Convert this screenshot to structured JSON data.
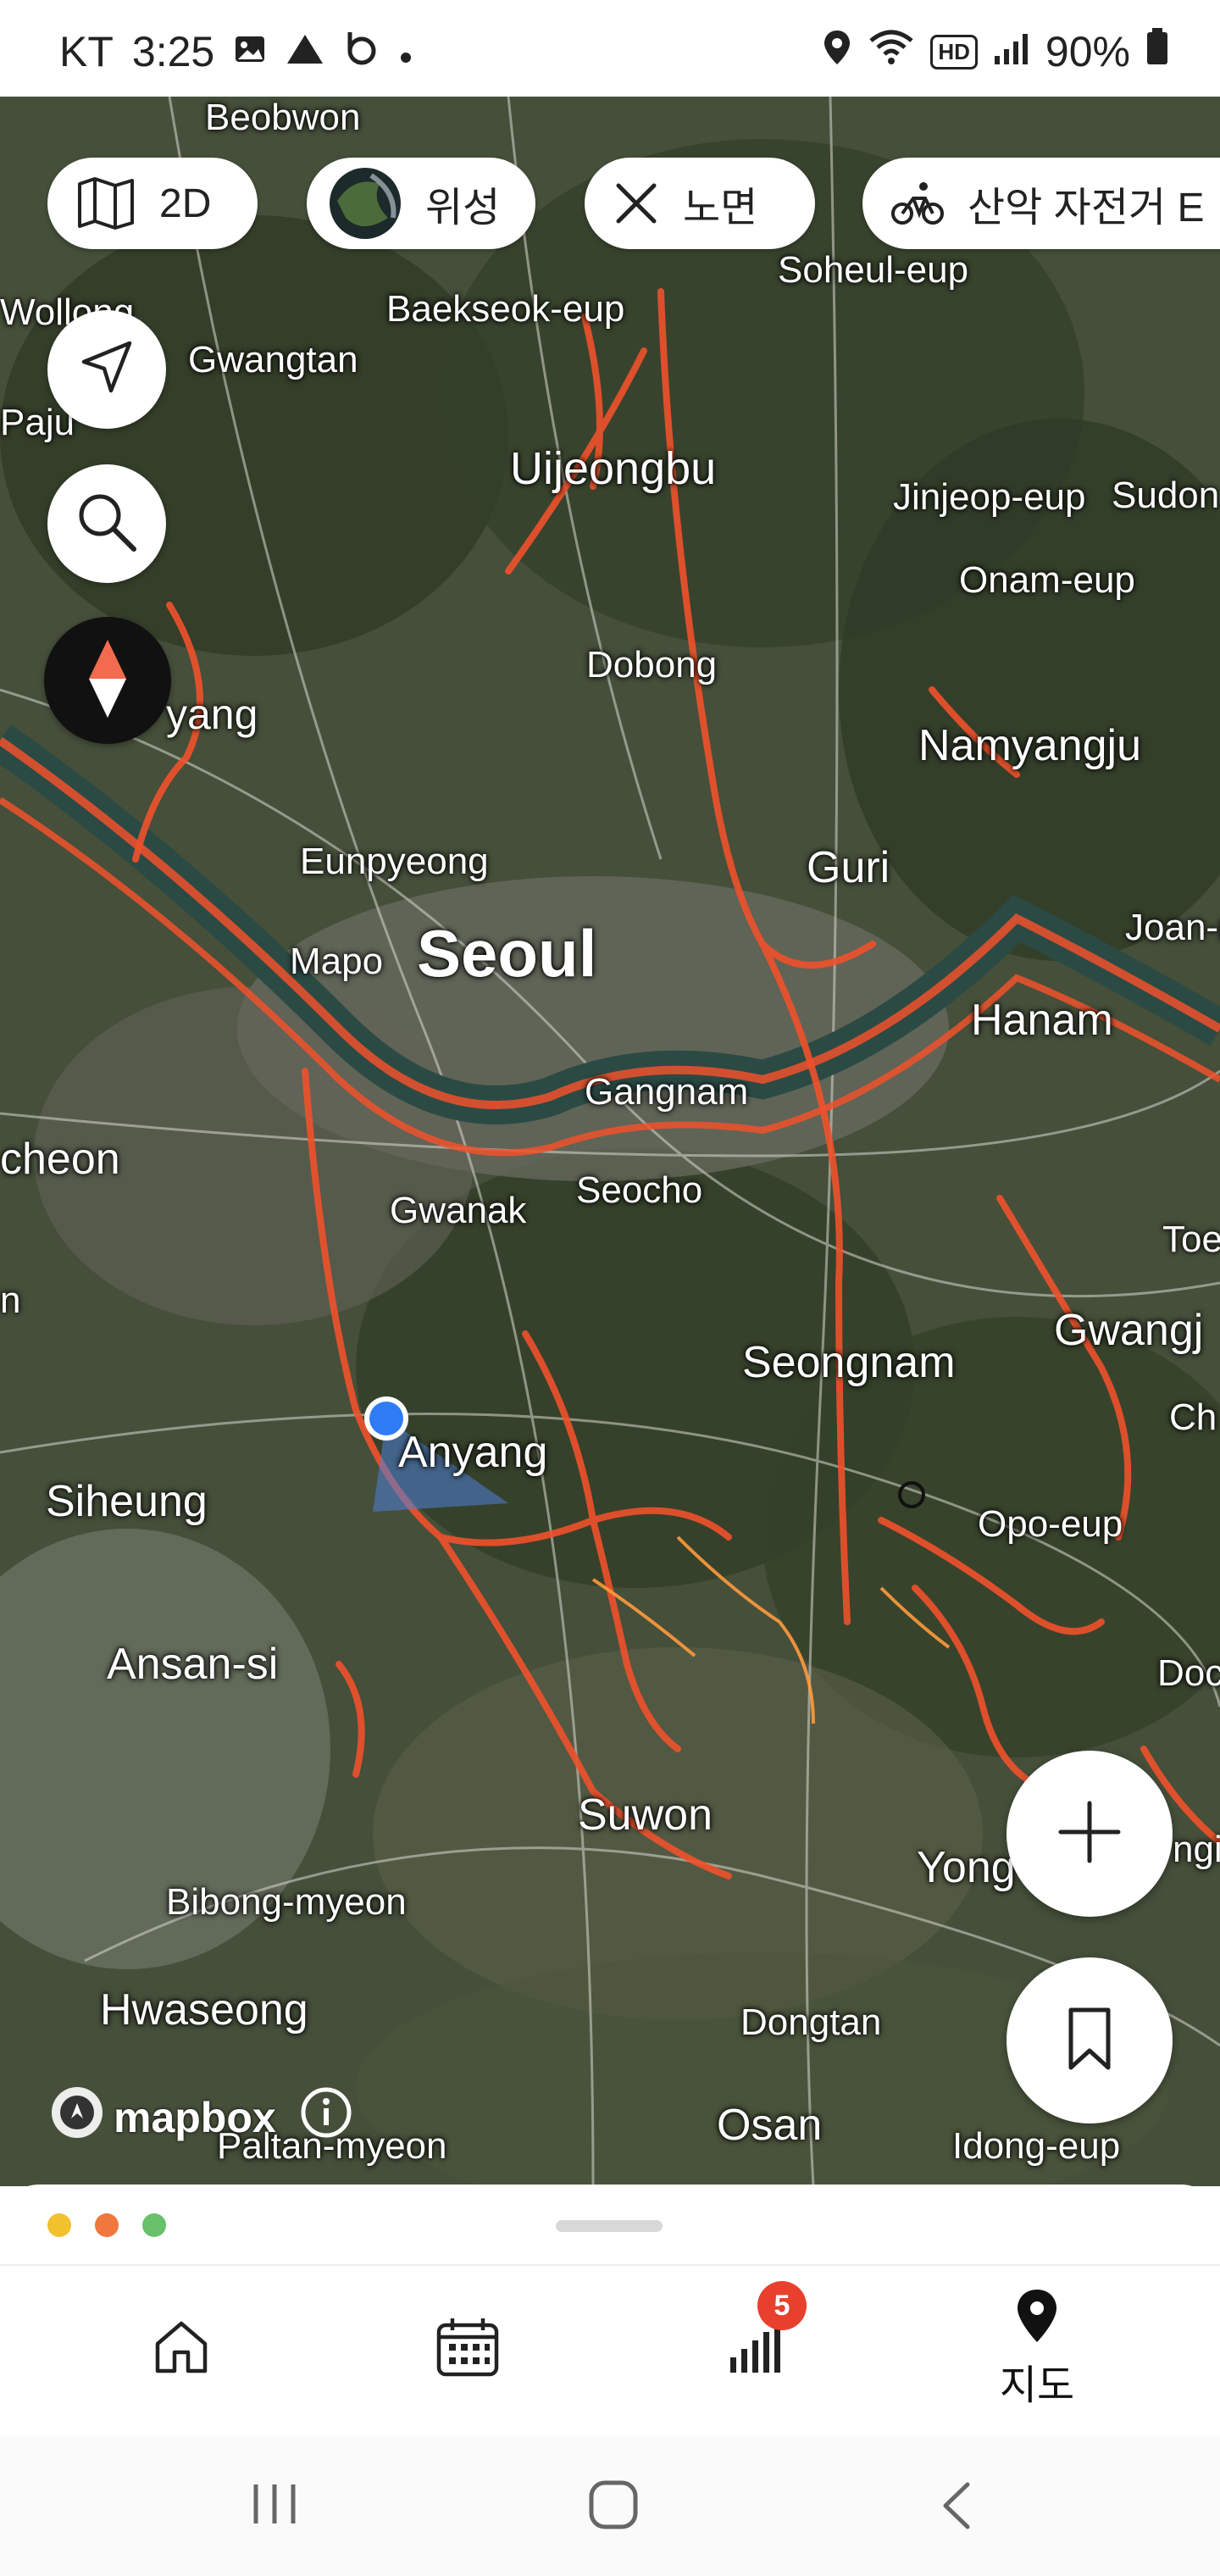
{
  "status_bar": {
    "carrier": "KT",
    "time": "3:25",
    "hd_label": "HD",
    "battery": "90%"
  },
  "map_chips": {
    "view_mode": "2D",
    "layer": "위성",
    "surface": "노면",
    "activity": "산악 자전거 E"
  },
  "map_places": {
    "beobwon": "Beobwon",
    "soheul": "Soheul-eup",
    "wollong": "Wollong",
    "baekseok": "Baekseok-eup",
    "gwangtan": "Gwangtan",
    "paju": "Paju",
    "uijeongbu": "Uijeongbu",
    "jinjeop": "Jinjeop-eup",
    "sudon": "Sudon",
    "onam": "Onam-eup",
    "dobong": "Dobong",
    "goyang": "yang",
    "namyangju": "Namyangju",
    "eunpyeong": "Eunpyeong",
    "guri": "Guri",
    "joan": "Joan-n",
    "mapo": "Mapo",
    "seoul": "Seoul",
    "hanam": "Hanam",
    "gangnam": "Gangnam",
    "bucheon": "cheon",
    "seocho": "Seocho",
    "gwanak": "Gwanak",
    "toe": "Toe",
    "gwangju": "Gwangj",
    "seongnam": "Seongnam",
    "ch": "Ch",
    "anyang": "Anyang",
    "siheung": "Siheung",
    "opo": "Opo-eup",
    "ansan": "Ansan-si",
    "do": "Doc",
    "suwon": "Suwon",
    "yongin": "Yong",
    "yongin2": "ngi",
    "bibong": "Bibong-myeon",
    "hwaseong": "Hwaseong",
    "dongtan": "Dongtan",
    "osan": "Osan",
    "idong": "Idong-eup",
    "paltan": "Paltan-myeon",
    "n": "n"
  },
  "attribution": "mapbox",
  "bottom_nav": {
    "map_label": "지도",
    "stats_badge": "5"
  },
  "colors": {
    "route": "#f0512b",
    "route_glow": "#ff9a3c",
    "location": "#2f7bf5",
    "badge": "#e8402c",
    "compass_red": "#f36b4f",
    "dot_yellow": "#f2c12e",
    "dot_orange": "#f0773d",
    "dot_green": "#67c06a"
  }
}
